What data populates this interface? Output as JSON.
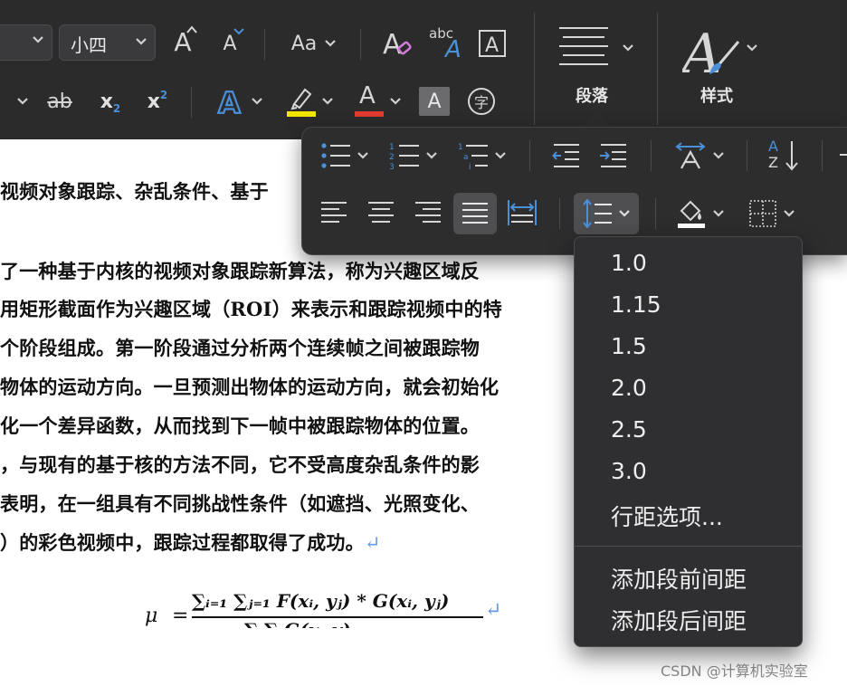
{
  "ribbon": {
    "font_size_value": "小四",
    "paragraph_label": "段落",
    "styles_label": "样式",
    "change_case_label": "Aa",
    "clear_format_label": "abc",
    "char_shading_label": "A",
    "phonetic_label": "字",
    "subscript_label": "x",
    "subscript_digit": "2",
    "superscript_label": "x",
    "superscript_digit": "2",
    "strike_label": "ab",
    "grow_font_label": "A",
    "shrink_font_label": "A",
    "text_effect_label": "A",
    "font_color_label": "A",
    "highlight_color": "#f2e600",
    "font_color": "#e23a2f",
    "accent_color": "#4a90d9"
  },
  "document": {
    "lines": [
      "视频对象跟踪、杂乱条件、基于",
      "了一种基于内核的视频对象跟踪新算法，称为兴趣区域反",
      "用矩形截面作为兴趣区域（ROI）来表示和跟踪视频中的特",
      "个阶段组成。第一阶段通过分析两个连续帧之间被跟踪物",
      "物体的运动方向。一旦预测出物体的运动方向，就会初始化",
      "化一个差异函数，从而找到下一帧中被跟踪物体的位置。",
      "，与现有的基于核的方法不同，它不受高度杂乱条件的影",
      "表明，在一组具有不同挑战性条件（如遮挡、光照变化、",
      "）的彩色视频中，跟踪过程都取得了成功。"
    ],
    "return_mark": "↵",
    "formula": {
      "lhs": "μ",
      "equals": "=",
      "numerator": "∑ᵢ₌₁ ∑ⱼ₌₁ F(xᵢ, yⱼ) * G(xᵢ, yⱼ)",
      "denominator": "∑ ∑ G(x, y)"
    }
  },
  "line_spacing_menu": {
    "options": [
      "1.0",
      "1.15",
      "1.5",
      "2.0",
      "2.5",
      "3.0",
      "行距选项..."
    ],
    "extra": [
      "添加段前间距",
      "添加段后间距"
    ]
  },
  "sort_labels": {
    "a": "A",
    "z": "Z"
  },
  "watermark": "CSDN @计算机实验室"
}
